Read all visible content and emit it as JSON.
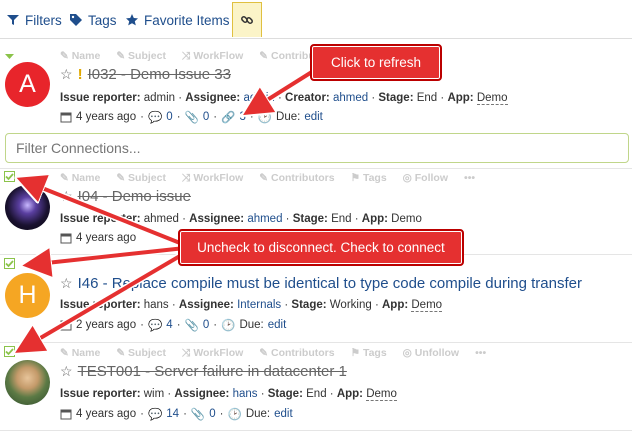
{
  "tabs": [
    {
      "label": "Filters",
      "icon": "filter-icon"
    },
    {
      "label": "Tags",
      "icon": "tags-icon"
    },
    {
      "label": "Favorite Items",
      "icon": "star-icon"
    },
    {
      "label": "",
      "icon": "link-icon"
    }
  ],
  "actions": {
    "name": "Name",
    "subject": "Subject",
    "workflow": "WorkFlow",
    "contributors": "Contributors",
    "tags": "Tags",
    "follow": "Follow",
    "unfollow": "Unfollow",
    "more": "•••"
  },
  "filter": {
    "placeholder": "Filter Connections..."
  },
  "callouts": {
    "refresh": "Click to refresh",
    "connect": "Uncheck to disconnect. Check to connect"
  },
  "labels": {
    "reporter": "Issue reporter:",
    "assignee": "Assignee:",
    "creator": "Creator:",
    "stage": "Stage:",
    "app": "App:",
    "due": "Due:",
    "edit": "edit"
  },
  "issues": [
    {
      "avatar_letter": "A",
      "avatar_color": "#e8252b",
      "title": "I032 - Demo Issue 33",
      "warn": "!",
      "reporter": "admin",
      "assignee": "admin",
      "creator": "ahmed",
      "stage": "End",
      "app": "Demo",
      "time": "4 years ago",
      "comments": "0",
      "attachments": "0",
      "links": "3"
    },
    {
      "avatar_letter": "",
      "avatar_color": "#2a2150",
      "title": "I04 - Demo issue",
      "reporter": "ahmed",
      "assignee": "ahmed",
      "stage": "End",
      "app": "Demo",
      "time": "4 years ago"
    },
    {
      "avatar_letter": "H",
      "avatar_color": "#f5a623",
      "title": "I46 - Replace compile must be identical to type code compile during transfer",
      "reporter": "hans",
      "assignee": "Internals",
      "stage": "Working",
      "app": "Demo",
      "time": "2 years ago",
      "comments": "4",
      "attachments": "0"
    },
    {
      "avatar_letter": "",
      "avatar_color": "#6b8e5a",
      "title": "TEST001 - Server failure in datacenter 1",
      "reporter": "wim",
      "assignee": "hans",
      "stage": "End",
      "app": "Demo",
      "time": "4 years ago",
      "comments": "14",
      "attachments": "0"
    }
  ]
}
